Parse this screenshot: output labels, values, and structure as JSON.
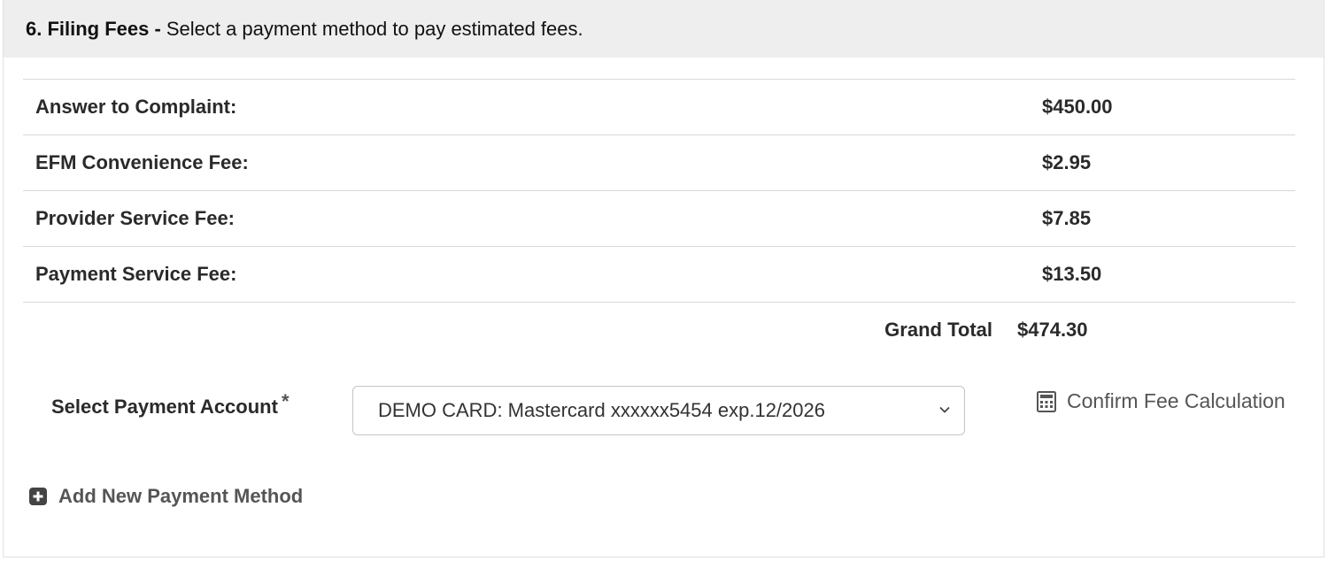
{
  "header": {
    "number_title": "6. Filing Fees -",
    "description": "Select a payment method to pay estimated fees."
  },
  "fees": [
    {
      "label": "Answer to Complaint:",
      "amount": "$450.00"
    },
    {
      "label": "EFM Convenience Fee:",
      "amount": "$2.95"
    },
    {
      "label": "Provider Service Fee:",
      "amount": "$7.85"
    },
    {
      "label": "Payment Service Fee:",
      "amount": "$13.50"
    }
  ],
  "total": {
    "label": "Grand Total",
    "amount": "$474.30"
  },
  "payment": {
    "label": "Select Payment Account",
    "required_marker": "*",
    "selected": "DEMO CARD: Mastercard xxxxxx5454 exp.12/2026"
  },
  "actions": {
    "confirm_label": "Confirm Fee Calculation",
    "add_method_label": "Add New Payment Method"
  },
  "icons": {
    "confirm": "calculator-icon",
    "add": "plus-square-icon",
    "select": "chevron-down-icon"
  }
}
